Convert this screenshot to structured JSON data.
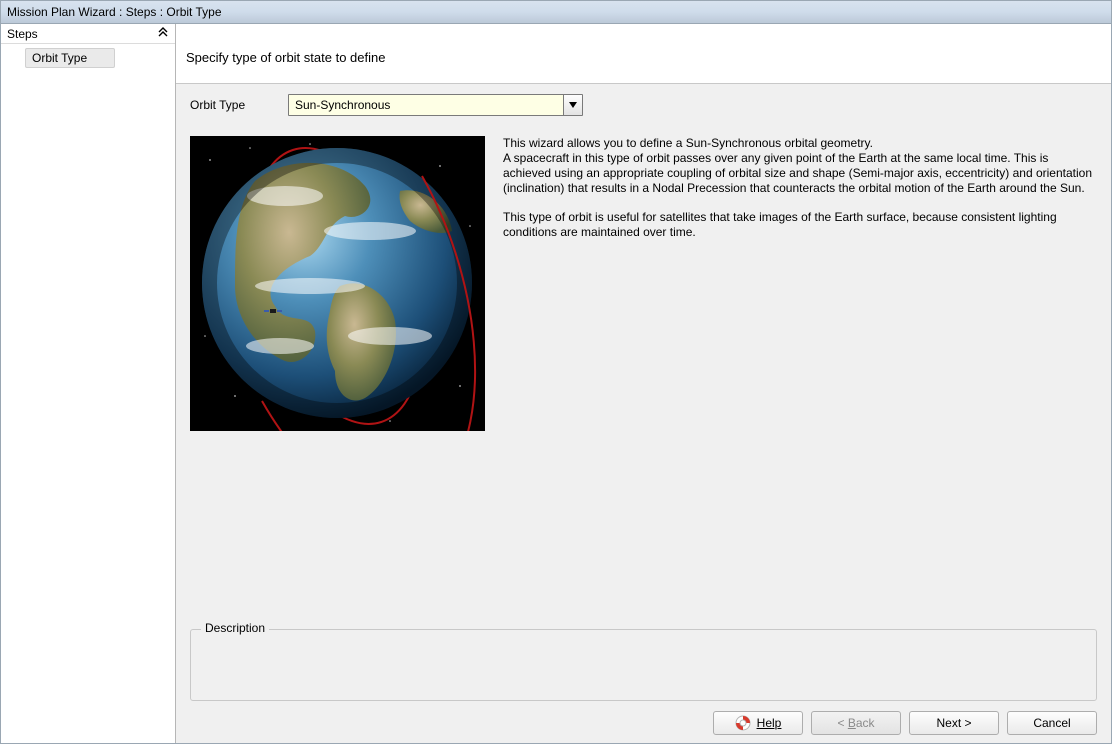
{
  "window": {
    "title": "Mission Plan Wizard : Steps : Orbit Type"
  },
  "sidebar": {
    "header": "Steps",
    "items": [
      {
        "label": "Orbit Type"
      }
    ]
  },
  "main": {
    "instruction": "Specify type of orbit state to define",
    "orbit_type_label": "Orbit Type",
    "orbit_type_value": "Sun-Synchronous",
    "description_heading": "Description",
    "info_para1": "This wizard allows you to define a Sun-Synchronous orbital geometry.\nA spacecraft in this type of orbit passes over any given point of the Earth at the same local time.  This is achieved using an appropriate coupling of orbital size and shape (Semi-major axis, eccentricity) and orientation (inclination) that results in a Nodal Precession that counteracts the orbital motion of the Earth around the Sun.",
    "info_para2": "This type of orbit is useful for satellites that take images of the Earth surface, because consistent lighting conditions are maintained over time."
  },
  "footer": {
    "help": "Help",
    "back": "< Back",
    "next": "Next >",
    "cancel": "Cancel"
  },
  "icons": {
    "collapse": "chevron-up-double-icon",
    "dropdown": "chevron-down-icon",
    "help": "lifebuoy-icon",
    "earth": "earth-globe-icon"
  }
}
